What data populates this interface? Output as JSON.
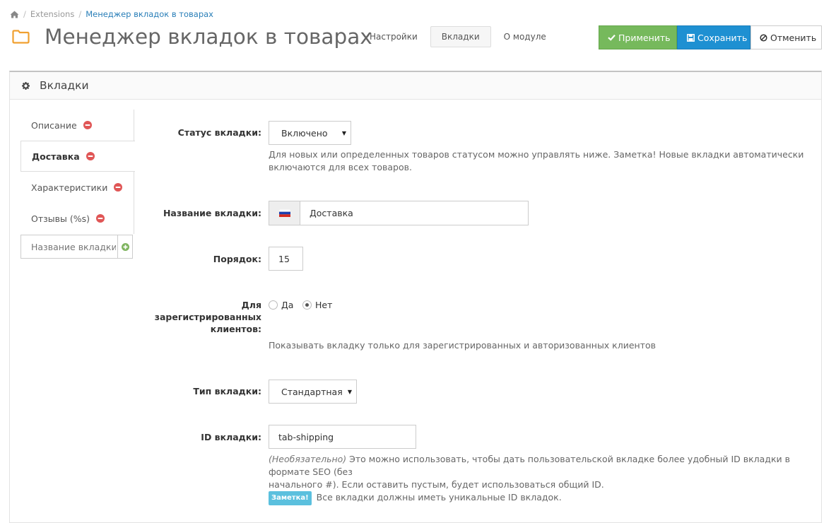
{
  "breadcrumb": {
    "home_icon": "home-icon",
    "items": [
      "Extensions",
      "Менеджер вкладок в товарах"
    ]
  },
  "header": {
    "title": "Менеджер вкладок в товарах",
    "icon": "folder-icon",
    "nav_tabs": [
      "Настройки",
      "Вкладки",
      "О модуле"
    ],
    "active_tab": "Вкладки"
  },
  "actions": {
    "apply": "Применить",
    "save": "Сохранить",
    "cancel": "Отменить",
    "apply_color": "#76b95c",
    "save_color": "#1e90d2"
  },
  "panel": {
    "title": "Вкладки",
    "icon": "gear-icon"
  },
  "sidebar": {
    "items": [
      {
        "label": "Описание",
        "active": false
      },
      {
        "label": "Доставка",
        "active": true
      },
      {
        "label": "Характеристики",
        "active": false
      },
      {
        "label": "Отзывы (%s)",
        "active": false
      }
    ],
    "add_placeholder": "Название вкладки",
    "remove_icon": "minus-circle-icon",
    "add_icon": "plus-circle-icon"
  },
  "form": {
    "status": {
      "label": "Статус вкладки:",
      "value": "Включено",
      "help": "Для новых или определенных товаров статусом можно управлять ниже. Заметка! Новые вкладки автоматически включаются для всех товаров."
    },
    "name": {
      "label": "Название вкладки:",
      "flag": "ru-flag-icon",
      "value": "Доставка"
    },
    "order": {
      "label": "Порядок:",
      "value": "15"
    },
    "registered": {
      "label_line1": "Для",
      "label_line2": "зарегистрированных",
      "label_line3": "клиентов:",
      "options": [
        "Да",
        "Нет"
      ],
      "selected": "Нет",
      "help": "Показывать вкладку только для зарегистрированных и авторизованных клиентов"
    },
    "type": {
      "label": "Тип вкладки:",
      "value": "Стандартная"
    },
    "tab_id": {
      "label": "ID вкладки:",
      "value": "tab-shipping",
      "help_optional": "(Необязательно)",
      "help_text_line1": " Это можно использовать, чтобы дать пользовательской вкладке более удобный ID вкладки в формате SEO (без",
      "help_text_line2": "начального #). Если оставить пустым, будет использоваться общий ID.",
      "note_label": "Заметка!",
      "note_text": " Все вкладки должны иметь уникальные ID вкладок."
    }
  }
}
